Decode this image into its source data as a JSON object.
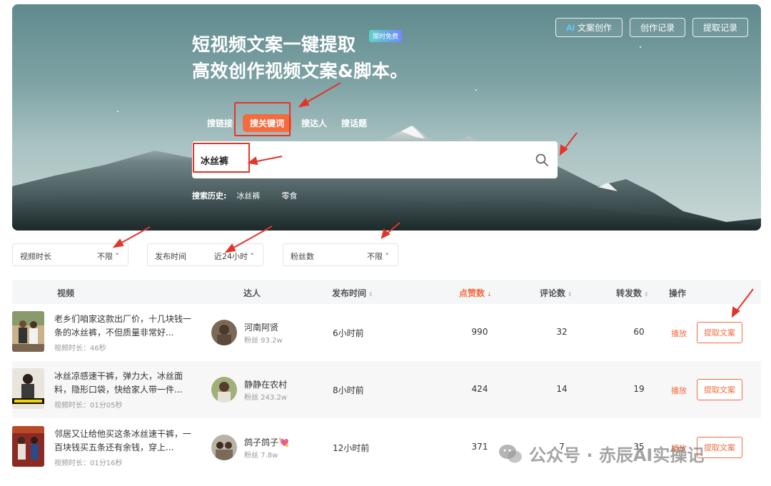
{
  "header": {
    "ai_button_prefix": "AI",
    "ai_button_label": "文案创作",
    "history_button": "创作记录",
    "extract_history_button": "提取记录"
  },
  "hero": {
    "headline_line1": "短视频文案一键提取",
    "headline_line2": "高效创作视频文案&脚本。",
    "badge": "限时免费"
  },
  "tabs": [
    {
      "label": "搜链接"
    },
    {
      "label": "搜关键词",
      "active": true
    },
    {
      "label": "搜达人"
    },
    {
      "label": "搜话题"
    }
  ],
  "search": {
    "value": "冰丝裤"
  },
  "history": {
    "label": "搜索历史:",
    "items": [
      "冰丝裤",
      "零食"
    ]
  },
  "filters": [
    {
      "label": "视频时长",
      "value": "不限 ˅"
    },
    {
      "label": "发布时间",
      "value": "近24小时 ˅"
    },
    {
      "label": "粉丝数",
      "value": "不限 ˅"
    }
  ],
  "table": {
    "columns": {
      "video": "视频",
      "creator": "达人",
      "published": "发布时间",
      "likes": "点赞数",
      "comments": "评论数",
      "shares": "转发数",
      "actions": "操作"
    },
    "sort_icon": "⇕",
    "sort_active_icon": "⇣",
    "rows": [
      {
        "title": "老乡们咱家这款出厂价，十几块钱一条的冰丝裤，不但质量非常好...",
        "duration": "视频时长：46秒",
        "creator": "河南阿贤",
        "fans": "粉丝 93.2w",
        "published": "6小时前",
        "likes": "990",
        "comments": "32",
        "shares": "60",
        "play": "播放",
        "extract": "提取文案"
      },
      {
        "title": "冰丝凉感速干裤，弹力大，冰丝面料，隐形口袋，快给家人带一件...",
        "duration": "视频时长：01分05秒",
        "creator": "静静在农村",
        "fans": "粉丝 243.2w",
        "published": "8小时前",
        "likes": "424",
        "comments": "14",
        "shares": "19",
        "play": "播放",
        "extract": "提取文案"
      },
      {
        "title": "邻居又让给他买这条冰丝速干裤，一百块钱买五条还有余钱，穿上...",
        "duration": "视频时长：01分16秒",
        "creator": "鸽子鸽子💘",
        "fans": "粉丝 7.8w",
        "published": "12小时前",
        "likes": "371",
        "comments": "7",
        "shares": "35",
        "play": "播放",
        "extract": "提取文案"
      }
    ]
  },
  "watermark": "公众号 · 赤辰AI实操记",
  "colors": {
    "accent": "#f36b3f",
    "annotation_red": "#e3342a"
  }
}
